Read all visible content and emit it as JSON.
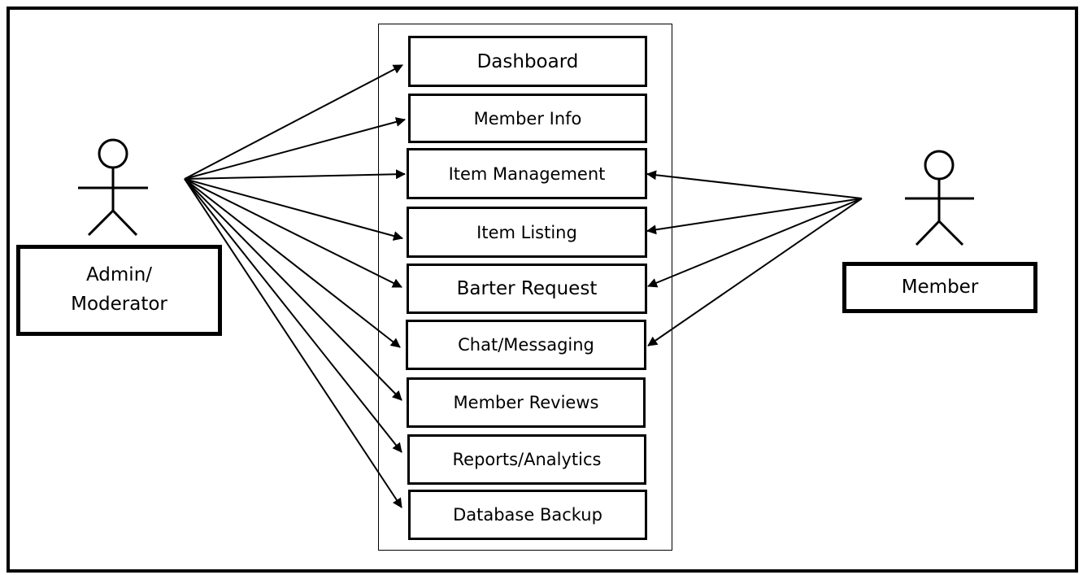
{
  "diagram": {
    "type": "use-case",
    "actors": [
      {
        "id": "admin",
        "label_lines": [
          "Admin/",
          "Moderator"
        ]
      },
      {
        "id": "member",
        "label_lines": [
          "Member"
        ]
      }
    ],
    "use_cases": [
      {
        "id": "dashboard",
        "label": "Dashboard"
      },
      {
        "id": "member-info",
        "label": "Member Info"
      },
      {
        "id": "item-management",
        "label": "Item Management"
      },
      {
        "id": "item-listing",
        "label": "Item Listing"
      },
      {
        "id": "barter-request",
        "label": "Barter Request"
      },
      {
        "id": "chat-messaging",
        "label": "Chat/Messaging"
      },
      {
        "id": "member-reviews",
        "label": "Member Reviews"
      },
      {
        "id": "reports-analytics",
        "label": "Reports/Analytics"
      },
      {
        "id": "database-backup",
        "label": "Database Backup"
      }
    ],
    "associations": [
      {
        "from": "admin",
        "to": "dashboard"
      },
      {
        "from": "admin",
        "to": "member-info"
      },
      {
        "from": "admin",
        "to": "item-management"
      },
      {
        "from": "admin",
        "to": "item-listing"
      },
      {
        "from": "admin",
        "to": "barter-request"
      },
      {
        "from": "admin",
        "to": "chat-messaging"
      },
      {
        "from": "admin",
        "to": "member-reviews"
      },
      {
        "from": "admin",
        "to": "reports-analytics"
      },
      {
        "from": "admin",
        "to": "database-backup"
      },
      {
        "from": "member",
        "to": "item-management"
      },
      {
        "from": "member",
        "to": "item-listing"
      },
      {
        "from": "member",
        "to": "barter-request"
      },
      {
        "from": "member",
        "to": "chat-messaging"
      }
    ]
  }
}
